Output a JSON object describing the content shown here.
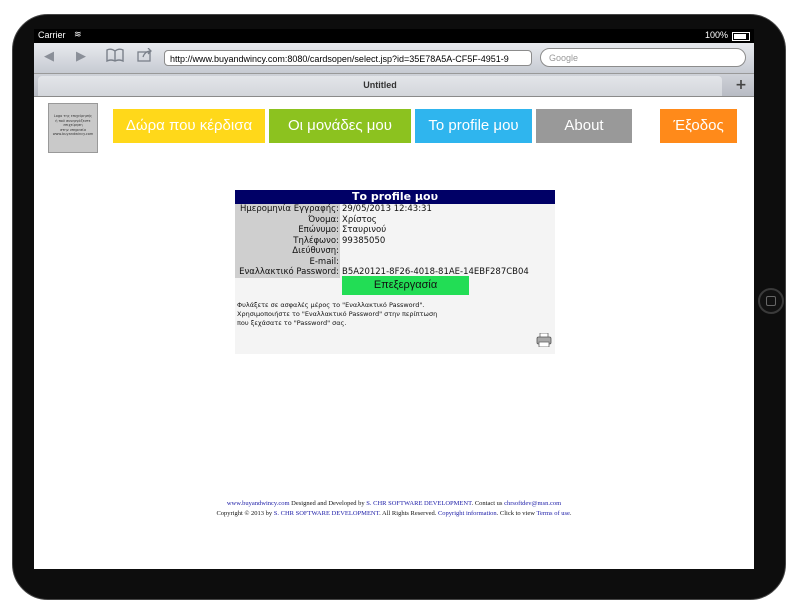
{
  "status_bar": {
    "carrier": "Carrier",
    "time": "",
    "battery": "100%"
  },
  "browser": {
    "url": "http://www.buyandwincy.com:8080/cardsopen/select.jsp?id=35E78A5A-CF5F-4951-9",
    "search_placeholder": "Google",
    "tab_title": "Untitled",
    "add_tab_label": "+"
  },
  "logo": {
    "lines": [
      "Logo της επιχείρησής",
      "ή πού συνεργάζεστε",
      "επιχείρηση",
      "στην υπηρεσία",
      "www.buyandwincy.com"
    ]
  },
  "nav": [
    {
      "label": "Δώρα που κέρδισα",
      "color": "#ffd81a"
    },
    {
      "label": "Οι μονάδες μου",
      "color": "#8cc21f"
    },
    {
      "label": "Το profile μου",
      "color": "#2fb5ee"
    },
    {
      "label": "About",
      "color": "#999999"
    },
    {
      "label": "Έξοδος",
      "color": "#ff8a1a"
    }
  ],
  "profile": {
    "title": "Το profile μου",
    "rows": [
      {
        "label": "Ημερομηνία Εγγραφής:",
        "value": "29/05/2013 12:43:31"
      },
      {
        "label": "Όνομα:",
        "value": "Χρίστος"
      },
      {
        "label": "Επώνυμο:",
        "value": "Σταυρινού"
      },
      {
        "label": "Τηλέφωνο:",
        "value": "99385050"
      },
      {
        "label": "Διεύθυνση:",
        "value": ""
      },
      {
        "label": "E-mail:",
        "value": ""
      },
      {
        "label": "Εναλλακτικό Password:",
        "value": "B5A20121-8F26-4018-81AE-14EBF287CB04"
      }
    ],
    "edit_label": "Επεξεργασία",
    "note_lines": [
      "Φυλάξετε σε ασφαλές μέρος το \"Εναλλακτικό Password\".",
      "Χρησιμοποιήστε το \"Εναλλακτικό Password\" στην περίπτωση",
      "που ξεχάσατε το \"Password\" σας."
    ]
  },
  "footer": {
    "site_link": "www.buyandwincy.com",
    "designed_text": " Designed and Developed by ",
    "company_link": "S. CHR SOFTWARE DEVELOPMENT",
    "contact_text": ". Contact us ",
    "email_link": "chrsoftdev@msn.com",
    "copyright_prefix": "Copyright © 2013 by ",
    "company_link2": "S. CHR SOFTWARE DEVELOPMENT",
    "rights_text": ". All Rights Reserved. ",
    "copyright_info_link": "Copyright information",
    "click_text": ". Click to view ",
    "terms_link": "Terms of use",
    "end_text": "."
  }
}
